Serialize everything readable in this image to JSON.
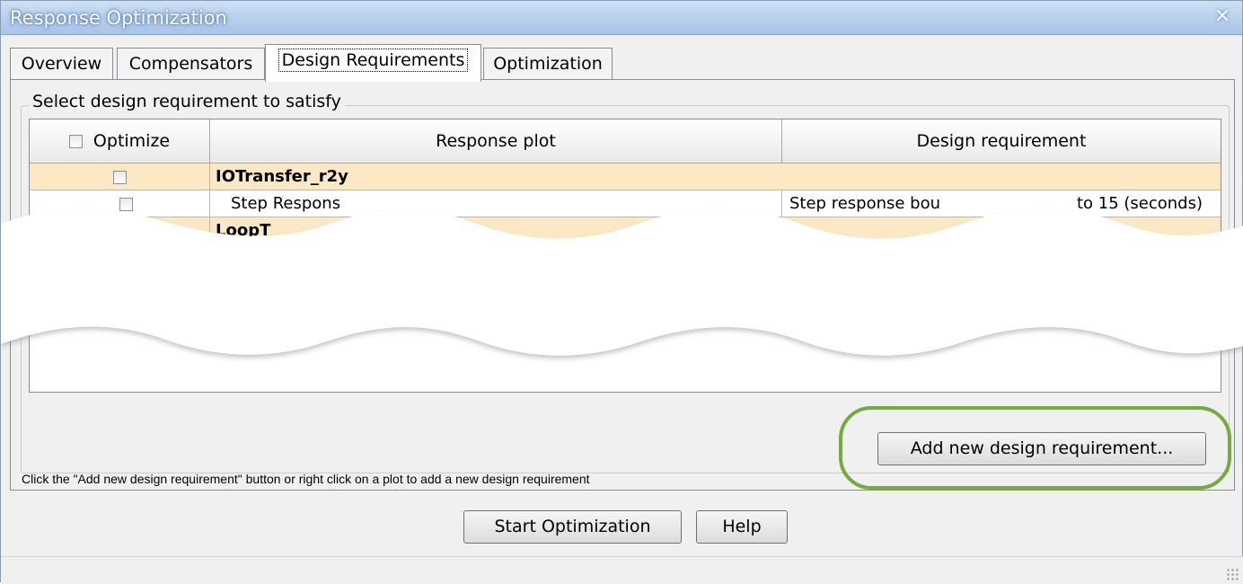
{
  "window": {
    "title": "Response Optimization",
    "close_glyph": "×"
  },
  "tabs": [
    {
      "label": "Overview"
    },
    {
      "label": "Compensators"
    },
    {
      "label": "Design Requirements"
    },
    {
      "label": "Optimization"
    }
  ],
  "active_tab": "Design Requirements",
  "group": {
    "label": "Select design requirement to satisfy"
  },
  "table": {
    "columns": [
      "Optimize",
      "Response plot",
      "Design requirement"
    ],
    "rows": [
      {
        "type": "group",
        "optimize_checked": false,
        "response_plot": "IOTransfer_r2y",
        "design_requirement": ""
      },
      {
        "type": "detail",
        "optimize_checked": true,
        "response_plot": "Step Respons",
        "design_requirement": "Step response bou"
      },
      {
        "type": "group",
        "optimize_checked": false,
        "response_plot": "LoopT",
        "design_requirement": ""
      }
    ],
    "fragment_right": "to 15 (seconds)"
  },
  "help_text": "Click the \"Add new design requirement\" button or right click on a plot to add a new design requirement",
  "buttons": {
    "add_requirement": "Add new design requirement...",
    "start_optimization": "Start Optimization",
    "help": "Help"
  },
  "colors": {
    "highlight_ring": "#75ab3c",
    "group_row": "#fce8c4",
    "titlebar": "#bcd3ef"
  }
}
